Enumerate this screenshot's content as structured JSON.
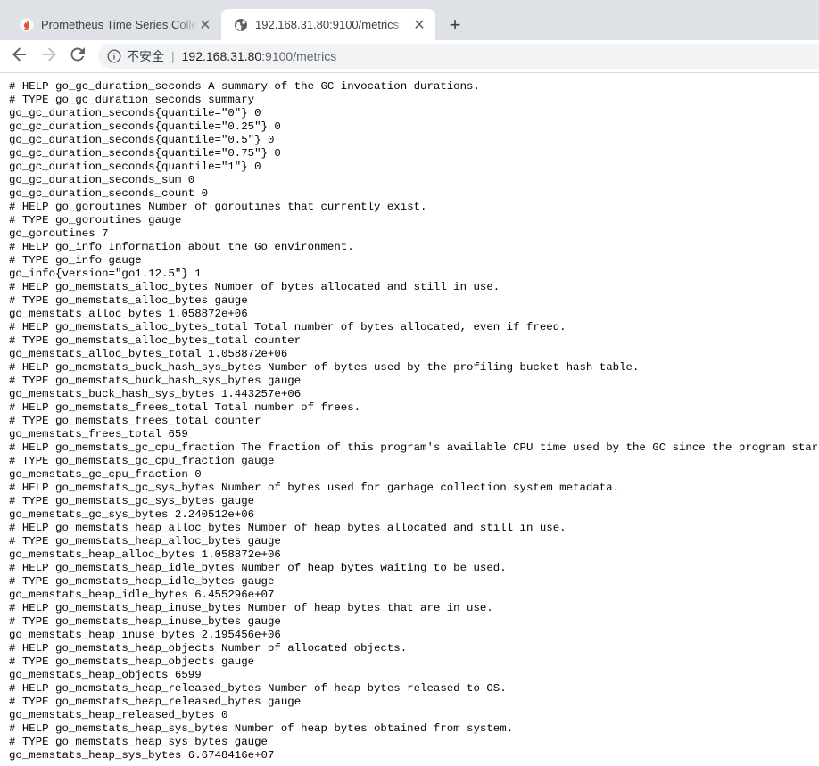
{
  "tabs": [
    {
      "title": "Prometheus Time Series Collec",
      "icon": "prometheus-flame-icon",
      "active": false
    },
    {
      "title": "192.168.31.80:9100/metrics",
      "icon": "globe-icon",
      "active": true
    }
  ],
  "tab_close_glyph": "✕",
  "new_tab_glyph": "+",
  "address_bar": {
    "security_label": "不安全",
    "divider": "|",
    "host": "192.168.31.80",
    "rest": ":9100/metrics"
  },
  "colors": {
    "tabstrip": "#dee1e6",
    "omnibox": "#f1f3f4",
    "prometheus_orange": "#e6522c"
  },
  "metrics_lines": [
    "# HELP go_gc_duration_seconds A summary of the GC invocation durations.",
    "# TYPE go_gc_duration_seconds summary",
    "go_gc_duration_seconds{quantile=\"0\"} 0",
    "go_gc_duration_seconds{quantile=\"0.25\"} 0",
    "go_gc_duration_seconds{quantile=\"0.5\"} 0",
    "go_gc_duration_seconds{quantile=\"0.75\"} 0",
    "go_gc_duration_seconds{quantile=\"1\"} 0",
    "go_gc_duration_seconds_sum 0",
    "go_gc_duration_seconds_count 0",
    "# HELP go_goroutines Number of goroutines that currently exist.",
    "# TYPE go_goroutines gauge",
    "go_goroutines 7",
    "# HELP go_info Information about the Go environment.",
    "# TYPE go_info gauge",
    "go_info{version=\"go1.12.5\"} 1",
    "# HELP go_memstats_alloc_bytes Number of bytes allocated and still in use.",
    "# TYPE go_memstats_alloc_bytes gauge",
    "go_memstats_alloc_bytes 1.058872e+06",
    "# HELP go_memstats_alloc_bytes_total Total number of bytes allocated, even if freed.",
    "# TYPE go_memstats_alloc_bytes_total counter",
    "go_memstats_alloc_bytes_total 1.058872e+06",
    "# HELP go_memstats_buck_hash_sys_bytes Number of bytes used by the profiling bucket hash table.",
    "# TYPE go_memstats_buck_hash_sys_bytes gauge",
    "go_memstats_buck_hash_sys_bytes 1.443257e+06",
    "# HELP go_memstats_frees_total Total number of frees.",
    "# TYPE go_memstats_frees_total counter",
    "go_memstats_frees_total 659",
    "# HELP go_memstats_gc_cpu_fraction The fraction of this program's available CPU time used by the GC since the program started.",
    "# TYPE go_memstats_gc_cpu_fraction gauge",
    "go_memstats_gc_cpu_fraction 0",
    "# HELP go_memstats_gc_sys_bytes Number of bytes used for garbage collection system metadata.",
    "# TYPE go_memstats_gc_sys_bytes gauge",
    "go_memstats_gc_sys_bytes 2.240512e+06",
    "# HELP go_memstats_heap_alloc_bytes Number of heap bytes allocated and still in use.",
    "# TYPE go_memstats_heap_alloc_bytes gauge",
    "go_memstats_heap_alloc_bytes 1.058872e+06",
    "# HELP go_memstats_heap_idle_bytes Number of heap bytes waiting to be used.",
    "# TYPE go_memstats_heap_idle_bytes gauge",
    "go_memstats_heap_idle_bytes 6.455296e+07",
    "# HELP go_memstats_heap_inuse_bytes Number of heap bytes that are in use.",
    "# TYPE go_memstats_heap_inuse_bytes gauge",
    "go_memstats_heap_inuse_bytes 2.195456e+06",
    "# HELP go_memstats_heap_objects Number of allocated objects.",
    "# TYPE go_memstats_heap_objects gauge",
    "go_memstats_heap_objects 6599",
    "# HELP go_memstats_heap_released_bytes Number of heap bytes released to OS.",
    "# TYPE go_memstats_heap_released_bytes gauge",
    "go_memstats_heap_released_bytes 0",
    "# HELP go_memstats_heap_sys_bytes Number of heap bytes obtained from system.",
    "# TYPE go_memstats_heap_sys_bytes gauge",
    "go_memstats_heap_sys_bytes 6.6748416e+07"
  ]
}
